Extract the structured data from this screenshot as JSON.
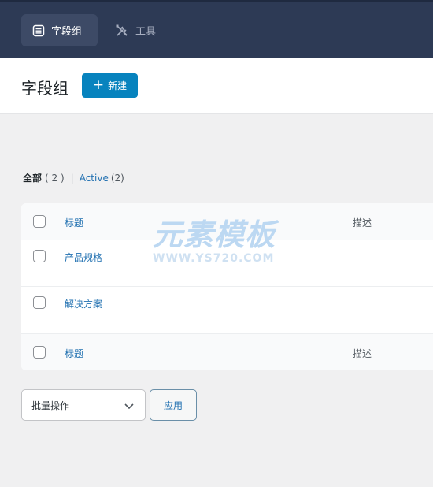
{
  "nav": {
    "tabs": [
      {
        "label": "字段组",
        "icon": "list-icon",
        "active": true
      },
      {
        "label": "工具",
        "icon": "tools-icon",
        "active": false
      }
    ]
  },
  "header": {
    "title": "字段组",
    "add_button": "新建"
  },
  "filters": {
    "all_label": "全部",
    "all_count": "( 2 )",
    "separator": "|",
    "active_label": "Active",
    "active_count": "(2)"
  },
  "table": {
    "columns": {
      "title": "标题",
      "description": "描述"
    },
    "rows": [
      {
        "title": "产品规格",
        "description": ""
      },
      {
        "title": "解决方案",
        "description": ""
      }
    ]
  },
  "bulk": {
    "select_value": "批量操作",
    "apply_label": "应用"
  },
  "watermark": {
    "text_cn": "元素模板",
    "text_en": "WWW.YS720.COM"
  },
  "colors": {
    "topbar": "#2d3a55",
    "accent": "#0783be",
    "link": "#2271b1"
  }
}
